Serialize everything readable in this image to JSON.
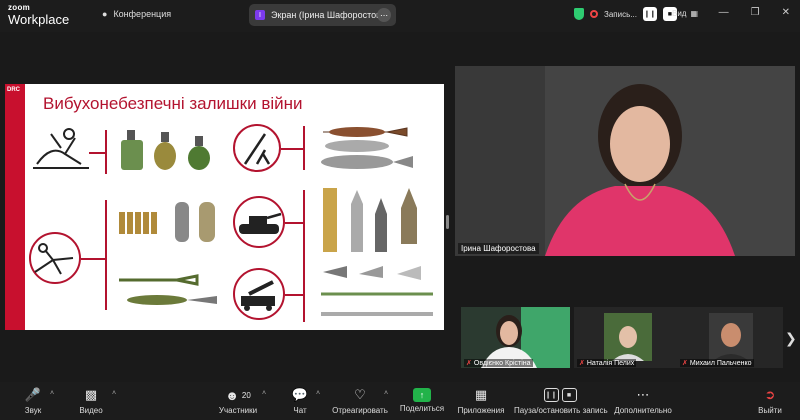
{
  "app": {
    "logo_top": "zoom",
    "logo_bottom": "Workplace",
    "conference_label": "Конференция",
    "share_pill_badge": "I",
    "share_pill_label": "Экран (Ірина Шафоростова)",
    "recording_label": "Запись...",
    "view_label": "Вид"
  },
  "slide": {
    "org": "DRC",
    "title": "Вибухонебезпечні залишки війни"
  },
  "main_video": {
    "name": "Ірина Шафоростова"
  },
  "thumbnails": [
    {
      "name": "Овдієнко Крістіна"
    },
    {
      "name": "Наталія Пелих"
    },
    {
      "name": "Михаил Пальченко"
    }
  ],
  "toolbar": {
    "audio": "Звук",
    "video": "Видео",
    "participants": "Участники",
    "participants_count": "20",
    "chat": "Чат",
    "react": "Отреагировать",
    "share": "Поделиться",
    "apps": "Приложения",
    "pause_record": "Пауза/остановить запись",
    "more": "Дополнительно",
    "leave": "Выйти"
  },
  "colors": {
    "accent_red": "#b3132f",
    "share_green": "#22b34a",
    "shield_green": "#2ecc71",
    "badge_purple": "#7c3aed"
  }
}
